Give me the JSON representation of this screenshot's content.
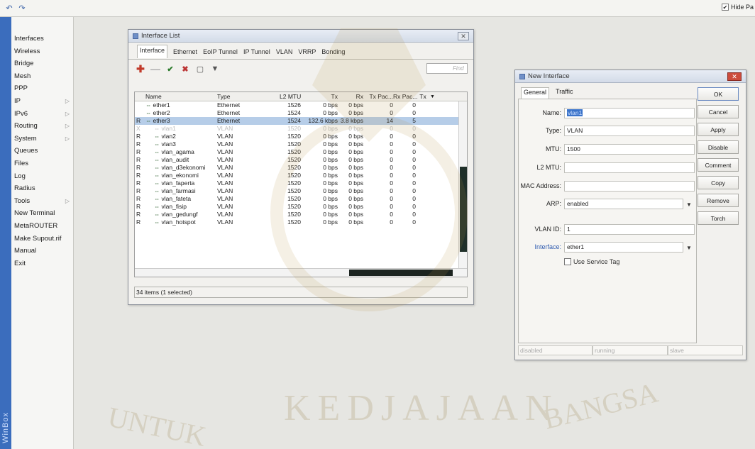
{
  "topbar": {
    "hide_passwords_label": "Hide Pa",
    "hide_passwords_checked": true
  },
  "sidebar": {
    "strip_label": "WinBox",
    "items": [
      {
        "label": "Interfaces",
        "sub": false
      },
      {
        "label": "Wireless",
        "sub": false
      },
      {
        "label": "Bridge",
        "sub": false
      },
      {
        "label": "Mesh",
        "sub": false
      },
      {
        "label": "PPP",
        "sub": false
      },
      {
        "label": "IP",
        "sub": true
      },
      {
        "label": "IPv6",
        "sub": true
      },
      {
        "label": "Routing",
        "sub": true
      },
      {
        "label": "System",
        "sub": true
      },
      {
        "label": "Queues",
        "sub": false
      },
      {
        "label": "Files",
        "sub": false
      },
      {
        "label": "Log",
        "sub": false
      },
      {
        "label": "Radius",
        "sub": false
      },
      {
        "label": "Tools",
        "sub": true
      },
      {
        "label": "New Terminal",
        "sub": false
      },
      {
        "label": "MetaROUTER",
        "sub": false
      },
      {
        "label": "Make Supout.rif",
        "sub": false
      },
      {
        "label": "Manual",
        "sub": false
      },
      {
        "label": "Exit",
        "sub": false
      }
    ]
  },
  "iflist": {
    "title": "Interface List",
    "tabs": [
      "Interface",
      "Ethernet",
      "EoIP Tunnel",
      "IP Tunnel",
      "VLAN",
      "VRRP",
      "Bonding"
    ],
    "find_placeholder": "Find",
    "columns": [
      "",
      "Name",
      "Type",
      "L2 MTU",
      "Tx",
      "Rx",
      "Tx Pac...",
      "Rx Pac...",
      "Tx"
    ],
    "rows": [
      {
        "flag": "",
        "name": "ether1",
        "type": "Ethernet",
        "mtu": "1526",
        "tx": "0 bps",
        "rx": "0 bps",
        "txp": "0",
        "rxp": "0",
        "level": 1,
        "selected": false,
        "disabled": false
      },
      {
        "flag": "",
        "name": "ether2",
        "type": "Ethernet",
        "mtu": "1524",
        "tx": "0 bps",
        "rx": "0 bps",
        "txp": "0",
        "rxp": "0",
        "level": 1,
        "selected": false,
        "disabled": false
      },
      {
        "flag": "R",
        "name": "ether3",
        "type": "Ethernet",
        "mtu": "1524",
        "tx": "132.6 kbps",
        "rx": "3.8 kbps",
        "txp": "14",
        "rxp": "5",
        "level": 1,
        "selected": true,
        "disabled": false
      },
      {
        "flag": "X",
        "name": "vlan1",
        "type": "VLAN",
        "mtu": "1520",
        "tx": "0 bps",
        "rx": "0 bps",
        "txp": "0",
        "rxp": "0",
        "level": 2,
        "selected": false,
        "disabled": true
      },
      {
        "flag": "R",
        "name": "vlan2",
        "type": "VLAN",
        "mtu": "1520",
        "tx": "0 bps",
        "rx": "0 bps",
        "txp": "0",
        "rxp": "0",
        "level": 2,
        "selected": false,
        "disabled": false
      },
      {
        "flag": "R",
        "name": "vlan3",
        "type": "VLAN",
        "mtu": "1520",
        "tx": "0 bps",
        "rx": "0 bps",
        "txp": "0",
        "rxp": "0",
        "level": 2,
        "selected": false,
        "disabled": false
      },
      {
        "flag": "R",
        "name": "vlan_agama",
        "type": "VLAN",
        "mtu": "1520",
        "tx": "0 bps",
        "rx": "0 bps",
        "txp": "0",
        "rxp": "0",
        "level": 2,
        "selected": false,
        "disabled": false
      },
      {
        "flag": "R",
        "name": "vlan_audit",
        "type": "VLAN",
        "mtu": "1520",
        "tx": "0 bps",
        "rx": "0 bps",
        "txp": "0",
        "rxp": "0",
        "level": 2,
        "selected": false,
        "disabled": false
      },
      {
        "flag": "R",
        "name": "vlan_d3ekonomi",
        "type": "VLAN",
        "mtu": "1520",
        "tx": "0 bps",
        "rx": "0 bps",
        "txp": "0",
        "rxp": "0",
        "level": 2,
        "selected": false,
        "disabled": false
      },
      {
        "flag": "R",
        "name": "vlan_ekonomi",
        "type": "VLAN",
        "mtu": "1520",
        "tx": "0 bps",
        "rx": "0 bps",
        "txp": "0",
        "rxp": "0",
        "level": 2,
        "selected": false,
        "disabled": false
      },
      {
        "flag": "R",
        "name": "vlan_faperta",
        "type": "VLAN",
        "mtu": "1520",
        "tx": "0 bps",
        "rx": "0 bps",
        "txp": "0",
        "rxp": "0",
        "level": 2,
        "selected": false,
        "disabled": false
      },
      {
        "flag": "R",
        "name": "vlan_farmasi",
        "type": "VLAN",
        "mtu": "1520",
        "tx": "0 bps",
        "rx": "0 bps",
        "txp": "0",
        "rxp": "0",
        "level": 2,
        "selected": false,
        "disabled": false
      },
      {
        "flag": "R",
        "name": "vlan_fateta",
        "type": "VLAN",
        "mtu": "1520",
        "tx": "0 bps",
        "rx": "0 bps",
        "txp": "0",
        "rxp": "0",
        "level": 2,
        "selected": false,
        "disabled": false
      },
      {
        "flag": "R",
        "name": "vlan_fisip",
        "type": "VLAN",
        "mtu": "1520",
        "tx": "0 bps",
        "rx": "0 bps",
        "txp": "0",
        "rxp": "0",
        "level": 2,
        "selected": false,
        "disabled": false
      },
      {
        "flag": "R",
        "name": "vlan_gedungf",
        "type": "VLAN",
        "mtu": "1520",
        "tx": "0 bps",
        "rx": "0 bps",
        "txp": "0",
        "rxp": "0",
        "level": 2,
        "selected": false,
        "disabled": false
      },
      {
        "flag": "R",
        "name": "vlan_hotspot",
        "type": "VLAN",
        "mtu": "1520",
        "tx": "0 bps",
        "rx": "0 bps",
        "txp": "0",
        "rxp": "0",
        "level": 2,
        "selected": false,
        "disabled": false
      }
    ],
    "status": "34 items (1 selected)"
  },
  "newif": {
    "title": "New Interface",
    "tabs": [
      "General",
      "Traffic"
    ],
    "fields": {
      "name": {
        "label": "Name:",
        "value": "vlan1"
      },
      "type": {
        "label": "Type:",
        "value": "VLAN"
      },
      "mtu": {
        "label": "MTU:",
        "value": "1500"
      },
      "l2mtu": {
        "label": "L2 MTU:",
        "value": ""
      },
      "mac": {
        "label": "MAC Address:",
        "value": ""
      },
      "arp": {
        "label": "ARP:",
        "value": "enabled"
      },
      "vlanid": {
        "label": "VLAN ID:",
        "value": "1"
      },
      "interface": {
        "label": "Interface:",
        "value": "ether1"
      }
    },
    "service_tag_label": "Use Service Tag",
    "buttons": [
      "OK",
      "Cancel",
      "Apply",
      "Disable",
      "Comment",
      "Copy",
      "Remove",
      "Torch"
    ],
    "status": [
      "disabled",
      "running",
      "slave"
    ]
  },
  "watermark": {
    "left_word": "UNTUK",
    "center_word": "KEDJAJAAN",
    "right_word": "BANGSA"
  },
  "colors": {
    "sidebar_strip": "#3b6dbd",
    "selected_row": "#b6cde8",
    "accent_blue": "#2f5bb0",
    "close_red": "#cc4b3c"
  }
}
